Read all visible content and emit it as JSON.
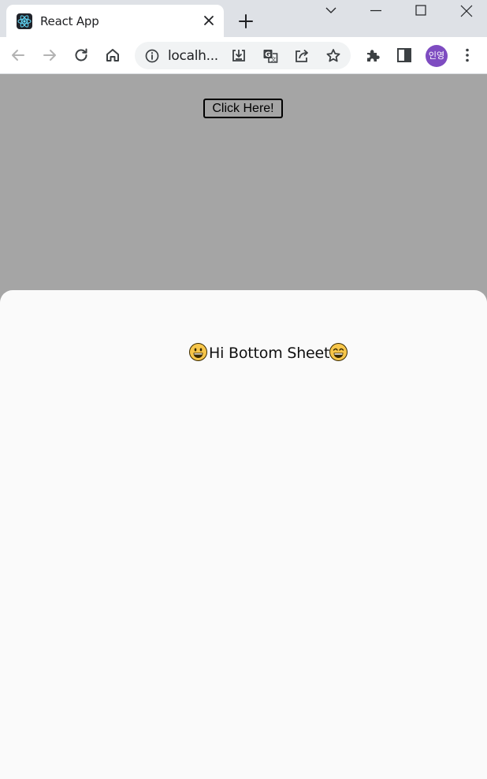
{
  "browser": {
    "tab": {
      "title": "React App",
      "favicon": "react-logo-icon"
    },
    "toolbar": {
      "url": "localh...",
      "profile_initials": "인영",
      "profile_color": "#7e4cc1"
    },
    "icons": [
      "chevron-down-icon",
      "minimize-icon",
      "maximize-icon",
      "close-icon",
      "back-icon",
      "forward-icon",
      "reload-icon",
      "home-icon",
      "info-icon",
      "install-icon",
      "translate-icon",
      "share-icon",
      "bookmark-star-icon",
      "extensions-icon",
      "side-panel-icon",
      "menu-icon"
    ]
  },
  "page": {
    "backdrop_color": "#a5a5a5",
    "button_label": "Click Here!",
    "sheet": {
      "background": "#fafafa",
      "message": "Hi Bottom Sheet!",
      "emoji_left": "grinning-face-icon",
      "emoji_right": "smiling-face-icon"
    }
  }
}
